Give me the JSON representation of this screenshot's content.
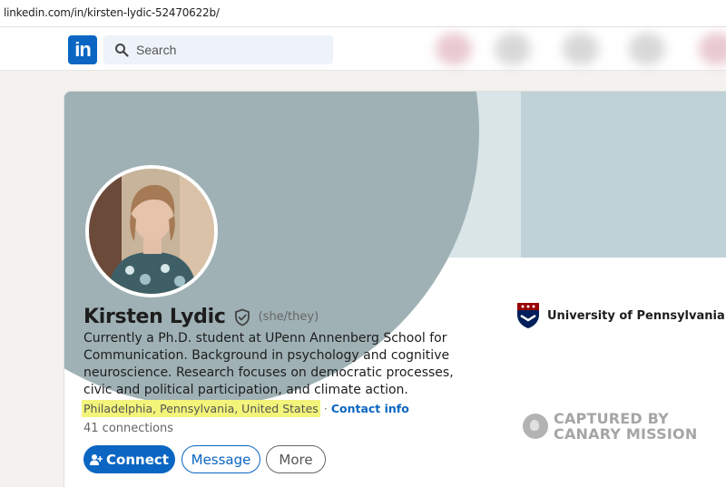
{
  "browser": {
    "url": "linkedin.com/in/kirsten-lydic-52470622b/"
  },
  "nav": {
    "logo_text": "in",
    "search_placeholder": "Search"
  },
  "profile": {
    "name": "Kirsten Lydic",
    "pronouns": "(she/they)",
    "headline": "Currently a Ph.D. student at UPenn Annenberg School for Communication. Background in psychology and cognitive neuroscience. Research focuses on democratic processes, civic and political participation, and climate action.",
    "location": "Philadelphia, Pennsylvania, United States",
    "separator": "·",
    "contact_info": "Contact info",
    "connections": "41 connections",
    "education": "University of Pennsylvania"
  },
  "actions": {
    "connect": "Connect",
    "message": "Message",
    "more": "More"
  },
  "watermark": {
    "line1": "CAPTURED BY",
    "line2": "CANARY MISSION"
  },
  "colors": {
    "brand": "#0a66c2",
    "highlight": "#f3f47a",
    "banner": "#9fb1b5"
  },
  "icons": [
    "search-icon",
    "verified-shield-icon",
    "add-person-icon",
    "penn-shield-icon",
    "canary-icon"
  ]
}
